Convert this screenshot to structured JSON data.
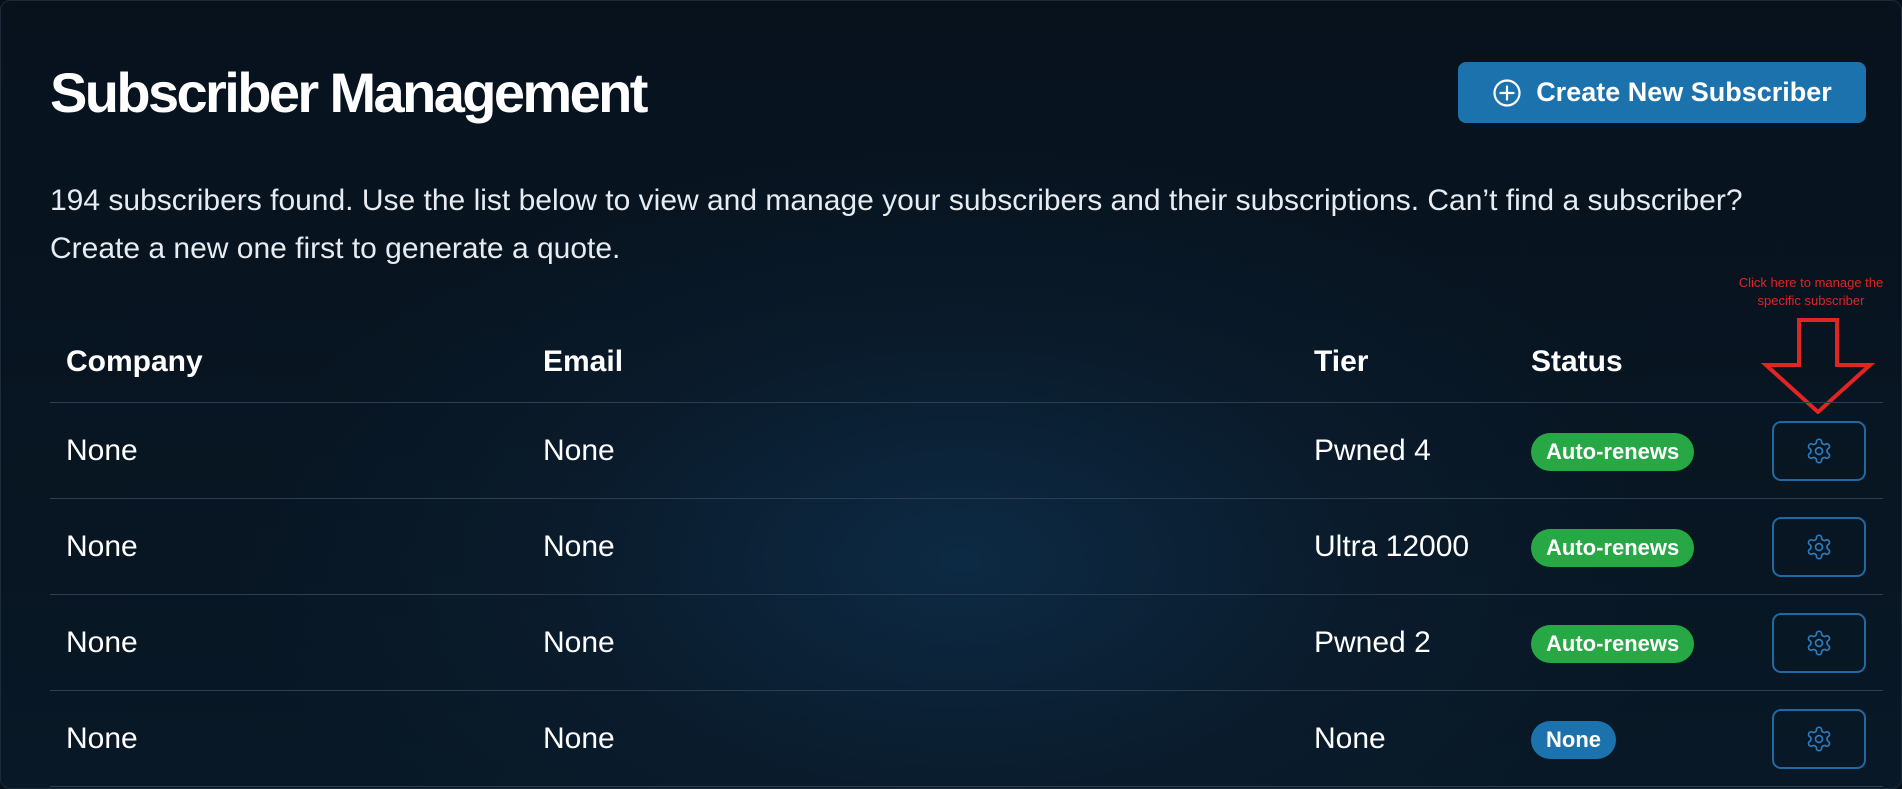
{
  "page": {
    "title": "Subscriber Management",
    "create_button_label": "Create New Subscriber",
    "intro": "194 subscribers found. Use the list below to view and manage your subscribers and their subscriptions. Can’t find a subscriber? Create a new one first to generate a quote."
  },
  "annotation": {
    "text": "Click here to manage the specific subscriber"
  },
  "table": {
    "columns": {
      "company": "Company",
      "email": "Email",
      "tier": "Tier",
      "status": "Status"
    },
    "rows": [
      {
        "company": "None",
        "email": "None",
        "tier": "Pwned 4",
        "status": "Auto-renews",
        "status_color": "#28a745"
      },
      {
        "company": "None",
        "email": "None",
        "tier": "Ultra 12000",
        "status": "Auto-renews",
        "status_color": "#28a745"
      },
      {
        "company": "None",
        "email": "None",
        "tier": "Pwned 2",
        "status": "Auto-renews",
        "status_color": "#28a745"
      },
      {
        "company": "None",
        "email": "None",
        "tier": "None",
        "status": "None",
        "status_color": "#1c72ac"
      }
    ]
  },
  "colors": {
    "accent": "#1c72ac",
    "success": "#28a745",
    "annotation": "#e12424"
  },
  "icons": {
    "create": "plus-circle-icon",
    "manage": "gear-icon",
    "annotation_arrow": "arrow-down-icon"
  }
}
